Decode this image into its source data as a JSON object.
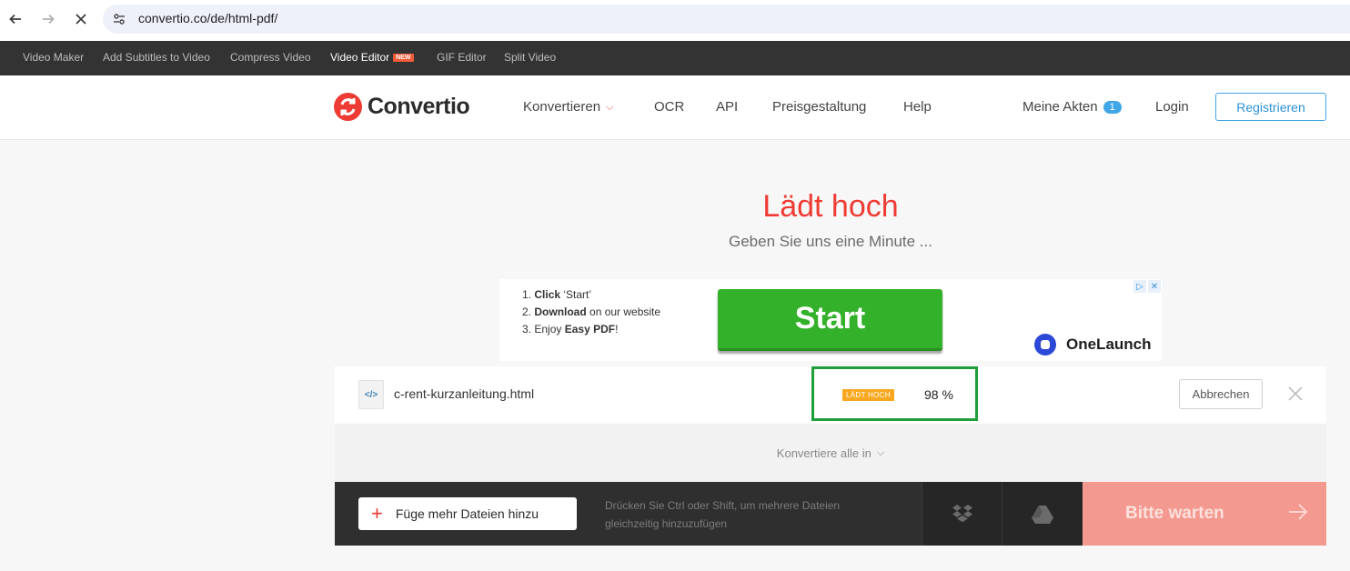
{
  "browser": {
    "url": "convertio.co/de/html-pdf/",
    "icons": {
      "back": "arrow-left-icon",
      "forward": "arrow-right-icon",
      "stop": "close-icon",
      "site": "tune-icon"
    }
  },
  "topbar": {
    "items": [
      {
        "label": "Video Maker"
      },
      {
        "label": "Add Subtitles to Video"
      },
      {
        "label": "Compress Video"
      },
      {
        "label": "Video Editor",
        "badge": "NEW"
      },
      {
        "label": "GIF Editor"
      },
      {
        "label": "Split Video"
      }
    ]
  },
  "header": {
    "logo_text": "Convertio",
    "menu": {
      "convert": "Konvertieren",
      "ocr": "OCR",
      "api": "API",
      "pricing": "Preisgestaltung",
      "help": "Help"
    },
    "my_files": "Meine Akten",
    "my_files_count": "1",
    "login": "Login",
    "register": "Registrieren"
  },
  "main": {
    "title": "Lädt hoch",
    "subtitle": "Geben Sie uns eine Minute ..."
  },
  "ad": {
    "step1_num": "1.",
    "step1_bold": "Click",
    "step1_rest": " ‘Start’",
    "step2_num": "2.",
    "step2_bold": "Download",
    "step2_rest": " on our website",
    "step3_num": "3.",
    "step3_pre": "Enjoy ",
    "step3_bold": "Easy PDF",
    "step3_rest": "!",
    "start_label": "Start",
    "brand": "OneLaunch"
  },
  "file": {
    "icon_glyph": "</>",
    "name": "c-rent-kurzanleitung.html",
    "status": "LÄDT HOCH",
    "percent": "98 %",
    "progress": 0.98,
    "cancel": "Abbrechen"
  },
  "convert_all": {
    "label": "Konvertiere alle in"
  },
  "bottom": {
    "add_files": "Füge mehr Dateien hinzu",
    "hint": "Drücken Sie Ctrl oder Shift, um mehrere Dateien gleichzeitig hinzuzufügen",
    "wait": "Bitte warten"
  },
  "colors": {
    "brand_red": "#ee3b33",
    "link_blue": "#41a6e6",
    "status_orange": "#f7a820",
    "highlight_green": "#1f9e3a",
    "ad_green": "#33b12a"
  }
}
